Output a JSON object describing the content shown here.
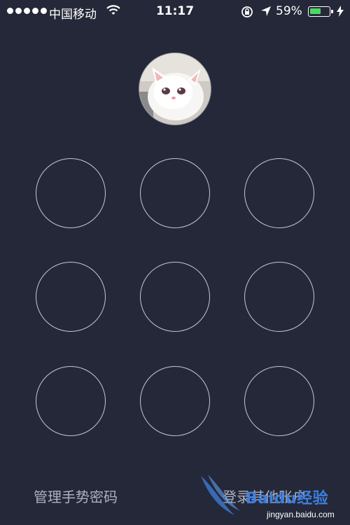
{
  "status_bar": {
    "carrier": "中国移动",
    "time": "11:17",
    "battery_percent": "59%",
    "battery_level": 0.59,
    "battery_color": "#4cd964"
  },
  "avatar": {
    "icon": "cat-photo-avatar"
  },
  "pattern_lock": {
    "dots": [
      "dot",
      "dot",
      "dot",
      "dot",
      "dot",
      "dot",
      "dot",
      "dot",
      "dot"
    ]
  },
  "footer": {
    "manage_label": "管理手势密码",
    "other_account_label": "登录其他账户"
  },
  "watermark": {
    "text": "Baidu经验",
    "url": "jingyan.baidu.com"
  },
  "colors": {
    "background": "#252838",
    "circle_stroke": "#c7c7d3",
    "link_text": "#aeb0bd"
  }
}
